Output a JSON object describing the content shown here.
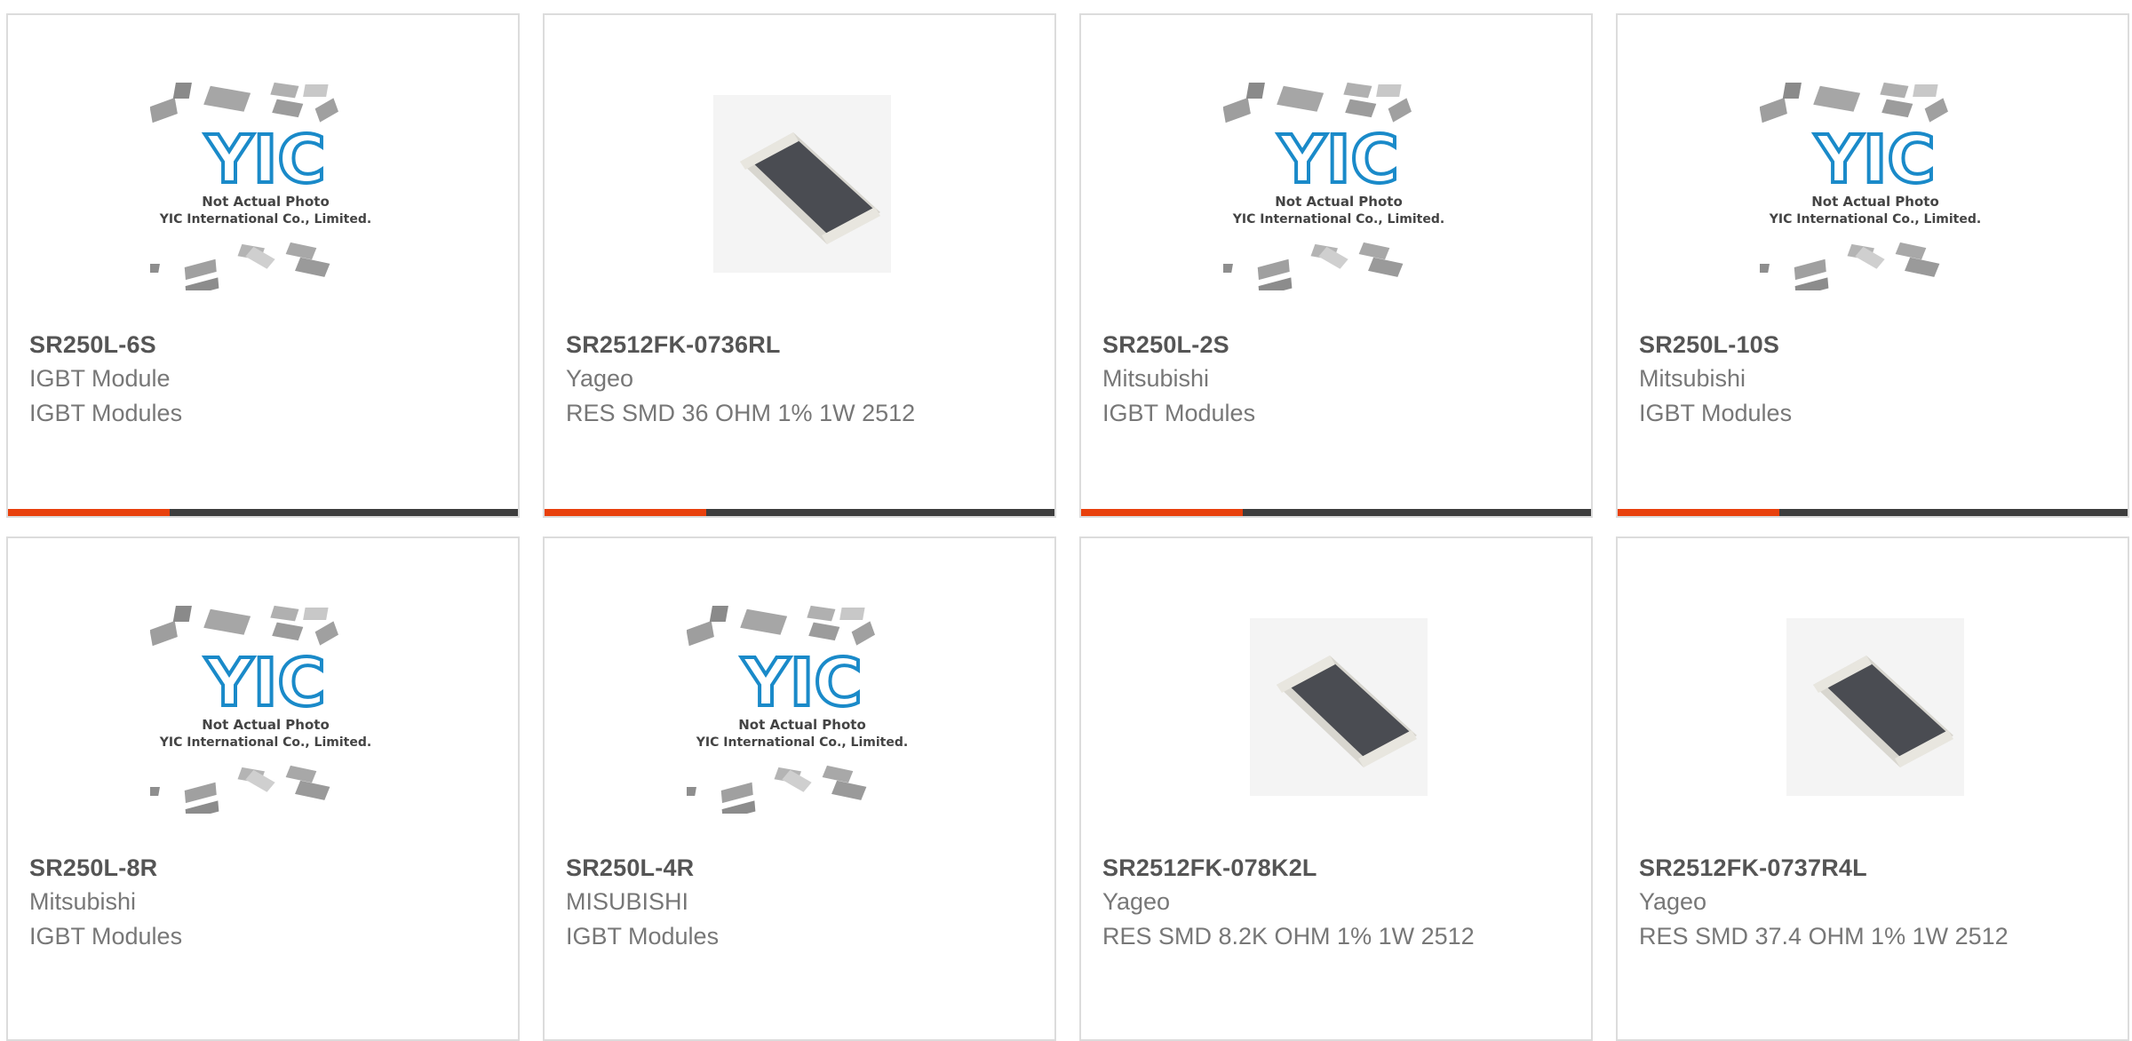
{
  "theme": {
    "accent": "#e8400c",
    "bar": "#3d3d3d",
    "yic_blue": "#1a8ac9"
  },
  "products": [
    {
      "part": "SR250L-6S",
      "manufacturer": "IGBT Module",
      "description": "IGBT Modules",
      "image": "placeholder-yic",
      "caption1": "Not Actual Photo",
      "caption2": "YIC International Co., Limited."
    },
    {
      "part": "SR2512FK-0736RL",
      "manufacturer": "Yageo",
      "description": "RES SMD 36 OHM 1% 1W 2512",
      "image": "smd-resistor"
    },
    {
      "part": "SR250L-2S",
      "manufacturer": "Mitsubishi",
      "description": "IGBT Modules",
      "image": "placeholder-yic",
      "caption1": "Not Actual Photo",
      "caption2": "YIC International Co., Limited."
    },
    {
      "part": "SR250L-10S",
      "manufacturer": "Mitsubishi",
      "description": "IGBT Modules",
      "image": "placeholder-yic",
      "caption1": "Not Actual Photo",
      "caption2": "YIC International Co., Limited."
    },
    {
      "part": "SR250L-8R",
      "manufacturer": "Mitsubishi",
      "description": "IGBT Modules",
      "image": "placeholder-yic",
      "caption1": "Not Actual Photo",
      "caption2": "YIC International Co., Limited."
    },
    {
      "part": "SR250L-4R",
      "manufacturer": "MISUBISHI",
      "description": "IGBT Modules",
      "image": "placeholder-yic",
      "caption1": "Not Actual Photo",
      "caption2": "YIC International Co., Limited."
    },
    {
      "part": "SR2512FK-078K2L",
      "manufacturer": "Yageo",
      "description": "RES SMD 8.2K OHM 1% 1W 2512",
      "image": "smd-resistor"
    },
    {
      "part": "SR2512FK-0737R4L",
      "manufacturer": "Yageo",
      "description": "RES SMD 37.4 OHM 1% 1W 2512",
      "image": "smd-resistor"
    }
  ]
}
